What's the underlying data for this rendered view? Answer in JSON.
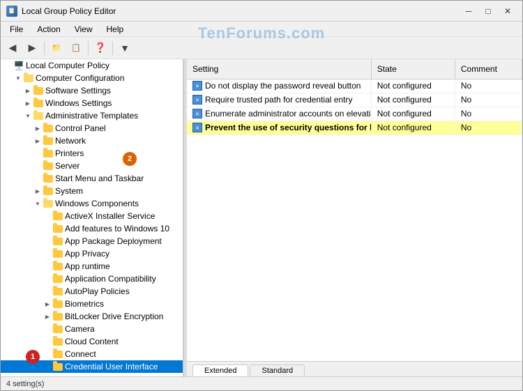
{
  "titleBar": {
    "title": "Local Group Policy Editor",
    "icon": "📋",
    "minimizeLabel": "─",
    "restoreLabel": "□",
    "closeLabel": "✕"
  },
  "watermark": "TenForums.com",
  "menuBar": {
    "items": [
      "File",
      "Action",
      "View",
      "Help"
    ]
  },
  "toolbar": {
    "buttons": [
      "◀",
      "▶",
      "⬆",
      "📋",
      "📋",
      "❓",
      "📋",
      "▼"
    ]
  },
  "tree": {
    "items": [
      {
        "id": "local-policy",
        "label": "Local Computer Policy",
        "indent": 0,
        "type": "computer",
        "expanded": true,
        "arrow": ""
      },
      {
        "id": "computer-config",
        "label": "Computer Configuration",
        "indent": 1,
        "type": "folder-open",
        "expanded": true,
        "arrow": "▼"
      },
      {
        "id": "software-settings",
        "label": "Software Settings",
        "indent": 2,
        "type": "folder",
        "expanded": false,
        "arrow": "▶"
      },
      {
        "id": "windows-settings",
        "label": "Windows Settings",
        "indent": 2,
        "type": "folder",
        "expanded": false,
        "arrow": "▶"
      },
      {
        "id": "admin-templates",
        "label": "Administrative Templates",
        "indent": 2,
        "type": "folder-open",
        "expanded": true,
        "arrow": "▼"
      },
      {
        "id": "control-panel",
        "label": "Control Panel",
        "indent": 3,
        "type": "folder",
        "expanded": false,
        "arrow": "▶"
      },
      {
        "id": "network",
        "label": "Network",
        "indent": 3,
        "type": "folder",
        "expanded": false,
        "arrow": "▶"
      },
      {
        "id": "printers",
        "label": "Printers",
        "indent": 3,
        "type": "folder",
        "expanded": false,
        "arrow": ""
      },
      {
        "id": "server",
        "label": "Server",
        "indent": 3,
        "type": "folder",
        "expanded": false,
        "arrow": ""
      },
      {
        "id": "start-menu",
        "label": "Start Menu and Taskbar",
        "indent": 3,
        "type": "folder",
        "expanded": false,
        "arrow": ""
      },
      {
        "id": "system",
        "label": "System",
        "indent": 3,
        "type": "folder",
        "expanded": false,
        "arrow": "▶"
      },
      {
        "id": "windows-components",
        "label": "Windows Components",
        "indent": 3,
        "type": "folder-open",
        "expanded": true,
        "arrow": "▼"
      },
      {
        "id": "activex",
        "label": "ActiveX Installer Service",
        "indent": 4,
        "type": "folder",
        "expanded": false,
        "arrow": ""
      },
      {
        "id": "add-features",
        "label": "Add features to Windows 10",
        "indent": 4,
        "type": "folder",
        "expanded": false,
        "arrow": ""
      },
      {
        "id": "app-package",
        "label": "App Package Deployment",
        "indent": 4,
        "type": "folder",
        "expanded": false,
        "arrow": ""
      },
      {
        "id": "app-privacy",
        "label": "App Privacy",
        "indent": 4,
        "type": "folder",
        "expanded": false,
        "arrow": ""
      },
      {
        "id": "app-runtime",
        "label": "App runtime",
        "indent": 4,
        "type": "folder",
        "expanded": false,
        "arrow": ""
      },
      {
        "id": "app-compat",
        "label": "Application Compatibility",
        "indent": 4,
        "type": "folder",
        "expanded": false,
        "arrow": ""
      },
      {
        "id": "autoplay",
        "label": "AutoPlay Policies",
        "indent": 4,
        "type": "folder",
        "expanded": false,
        "arrow": ""
      },
      {
        "id": "biometrics",
        "label": "Biometrics",
        "indent": 4,
        "type": "folder",
        "expanded": false,
        "arrow": "▶"
      },
      {
        "id": "bitlocker",
        "label": "BitLocker Drive Encryption",
        "indent": 4,
        "type": "folder",
        "expanded": false,
        "arrow": "▶"
      },
      {
        "id": "camera",
        "label": "Camera",
        "indent": 4,
        "type": "folder",
        "expanded": false,
        "arrow": ""
      },
      {
        "id": "cloud-content",
        "label": "Cloud Content",
        "indent": 4,
        "type": "folder",
        "expanded": false,
        "arrow": ""
      },
      {
        "id": "connect",
        "label": "Connect",
        "indent": 4,
        "type": "folder",
        "expanded": false,
        "arrow": ""
      },
      {
        "id": "credential-ui",
        "label": "Credential User Interface",
        "indent": 4,
        "type": "folder",
        "expanded": false,
        "arrow": "",
        "selected": true
      }
    ]
  },
  "tableHeaders": [
    {
      "id": "setting",
      "label": "Setting",
      "width": "55%"
    },
    {
      "id": "state",
      "label": "State",
      "width": "25%"
    },
    {
      "id": "comment",
      "label": "Comment",
      "width": "20%"
    }
  ],
  "tableRows": [
    {
      "id": "row1",
      "setting": "Do not display the password reveal button",
      "state": "Not configured",
      "comment": "No",
      "highlighted": false
    },
    {
      "id": "row2",
      "setting": "Require trusted path for credential entry",
      "state": "Not configured",
      "comment": "No",
      "highlighted": false
    },
    {
      "id": "row3",
      "setting": "Enumerate administrator accounts on elevation",
      "state": "Not configured",
      "comment": "No",
      "highlighted": false
    },
    {
      "id": "row4",
      "setting": "Prevent the use of security questions for local accounts",
      "state": "Not configured",
      "comment": "No",
      "highlighted": true
    }
  ],
  "tabs": [
    {
      "id": "extended",
      "label": "Extended",
      "active": true
    },
    {
      "id": "standard",
      "label": "Standard",
      "active": false
    }
  ],
  "statusBar": {
    "text": "4 setting(s)"
  },
  "badges": [
    {
      "id": "badge1",
      "number": "1",
      "color": "red"
    },
    {
      "id": "badge2",
      "number": "2",
      "color": "orange"
    }
  ]
}
